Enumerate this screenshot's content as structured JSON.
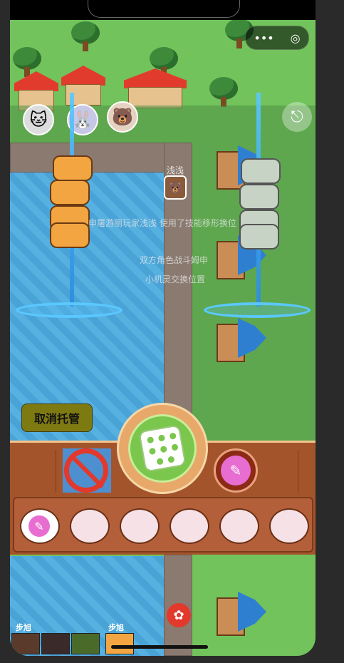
{
  "top_capsule": {
    "more_icon": "•••",
    "target_icon": "◎"
  },
  "players": [
    {
      "name": "",
      "avatar": "cat-avatar",
      "emoji": "🐱"
    },
    {
      "name": "",
      "avatar": "rabbit-avatar",
      "emoji": "🐰"
    },
    {
      "name": "",
      "avatar": "bear-avatar",
      "emoji": "🐻"
    }
  ],
  "board": {
    "player_tag": "浅浅",
    "messages": [
      "申屠游丽玩家浅浅 使用了技能移形换位",
      "双方角色战斗姆申",
      "小机灵交换位置"
    ]
  },
  "controls": {
    "cancel_auto": "取消托管",
    "logout_icon": "⎋",
    "dice_icon": "dice-icon",
    "skill_icon": "feather-icon"
  },
  "tray": {
    "cards": [
      {
        "state": "feather"
      },
      {
        "state": "empty"
      },
      {
        "state": "empty"
      },
      {
        "state": "empty"
      },
      {
        "state": "empty"
      },
      {
        "state": "empty"
      }
    ]
  },
  "bottom_labels": [
    "步旭",
    "步旭"
  ],
  "colors": {
    "accent": "#e86dd0",
    "panel": "#a4542b",
    "dice_green": "#7bc64c",
    "water": "#4aa3d6"
  }
}
